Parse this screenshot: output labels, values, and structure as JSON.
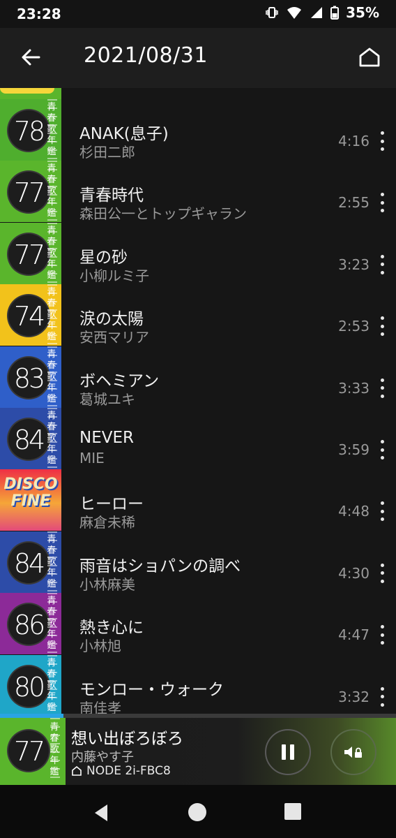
{
  "status_bar": {
    "time": "23:28",
    "battery": "35%",
    "icons": [
      "vibrate-icon",
      "wifi-icon",
      "signal-icon",
      "battery-icon"
    ]
  },
  "app_bar": {
    "title": "2021/08/31",
    "back_icon": "arrow-left-icon",
    "home_icon": "home-icon"
  },
  "album_art": {
    "series_vertical_text": "青春歌年鑑",
    "disco_text": "DISCO FINE"
  },
  "tracks": [
    {
      "title": "ANAK(息子)",
      "artist": "杉田二郎",
      "duration": "4:16",
      "art_year": "78",
      "art_color": "#4fae2e"
    },
    {
      "title": "青春時代",
      "artist": "森田公一とトップギャラン",
      "duration": "2:55",
      "art_year": "77",
      "art_color": "#5ab52c"
    },
    {
      "title": "星の砂",
      "artist": "小柳ルミ子",
      "duration": "3:23",
      "art_year": "77",
      "art_color": "#5ab52c"
    },
    {
      "title": "涙の太陽",
      "artist": "安西マリア",
      "duration": "2:53",
      "art_year": "74",
      "art_color": "#f2c21b"
    },
    {
      "title": "ボヘミアン",
      "artist": "葛城ユキ",
      "duration": "3:33",
      "art_year": "83",
      "art_color": "#2f5fc9"
    },
    {
      "title": "NEVER",
      "artist": "MIE",
      "duration": "3:59",
      "art_year": "84",
      "art_color": "#2d4ca8"
    },
    {
      "title": "ヒーロー",
      "artist": "麻倉未稀",
      "duration": "4:48",
      "art_year": "",
      "art_color": "#ee2f45"
    },
    {
      "title": "雨音はショパンの調べ",
      "artist": "小林麻美",
      "duration": "4:30",
      "art_year": "84",
      "art_color": "#2d4ca8"
    },
    {
      "title": "熱き心に",
      "artist": "小林旭",
      "duration": "4:47",
      "art_year": "86",
      "art_color": "#8c2a98"
    },
    {
      "title": "モンロー・ウォーク",
      "artist": "南佳孝",
      "duration": "3:32",
      "art_year": "80",
      "art_color": "#1fa6c8"
    }
  ],
  "now_playing": {
    "title": "想い出ぼろぼろ",
    "artist": "内藤やす子",
    "device": "NODE 2i-FBC8",
    "art_year": "77",
    "progress": 0.16,
    "accent_color": "#2aa4e4"
  },
  "nav_bar": {
    "icons": [
      "nav-back-icon",
      "nav-home-icon",
      "nav-recents-icon"
    ]
  }
}
